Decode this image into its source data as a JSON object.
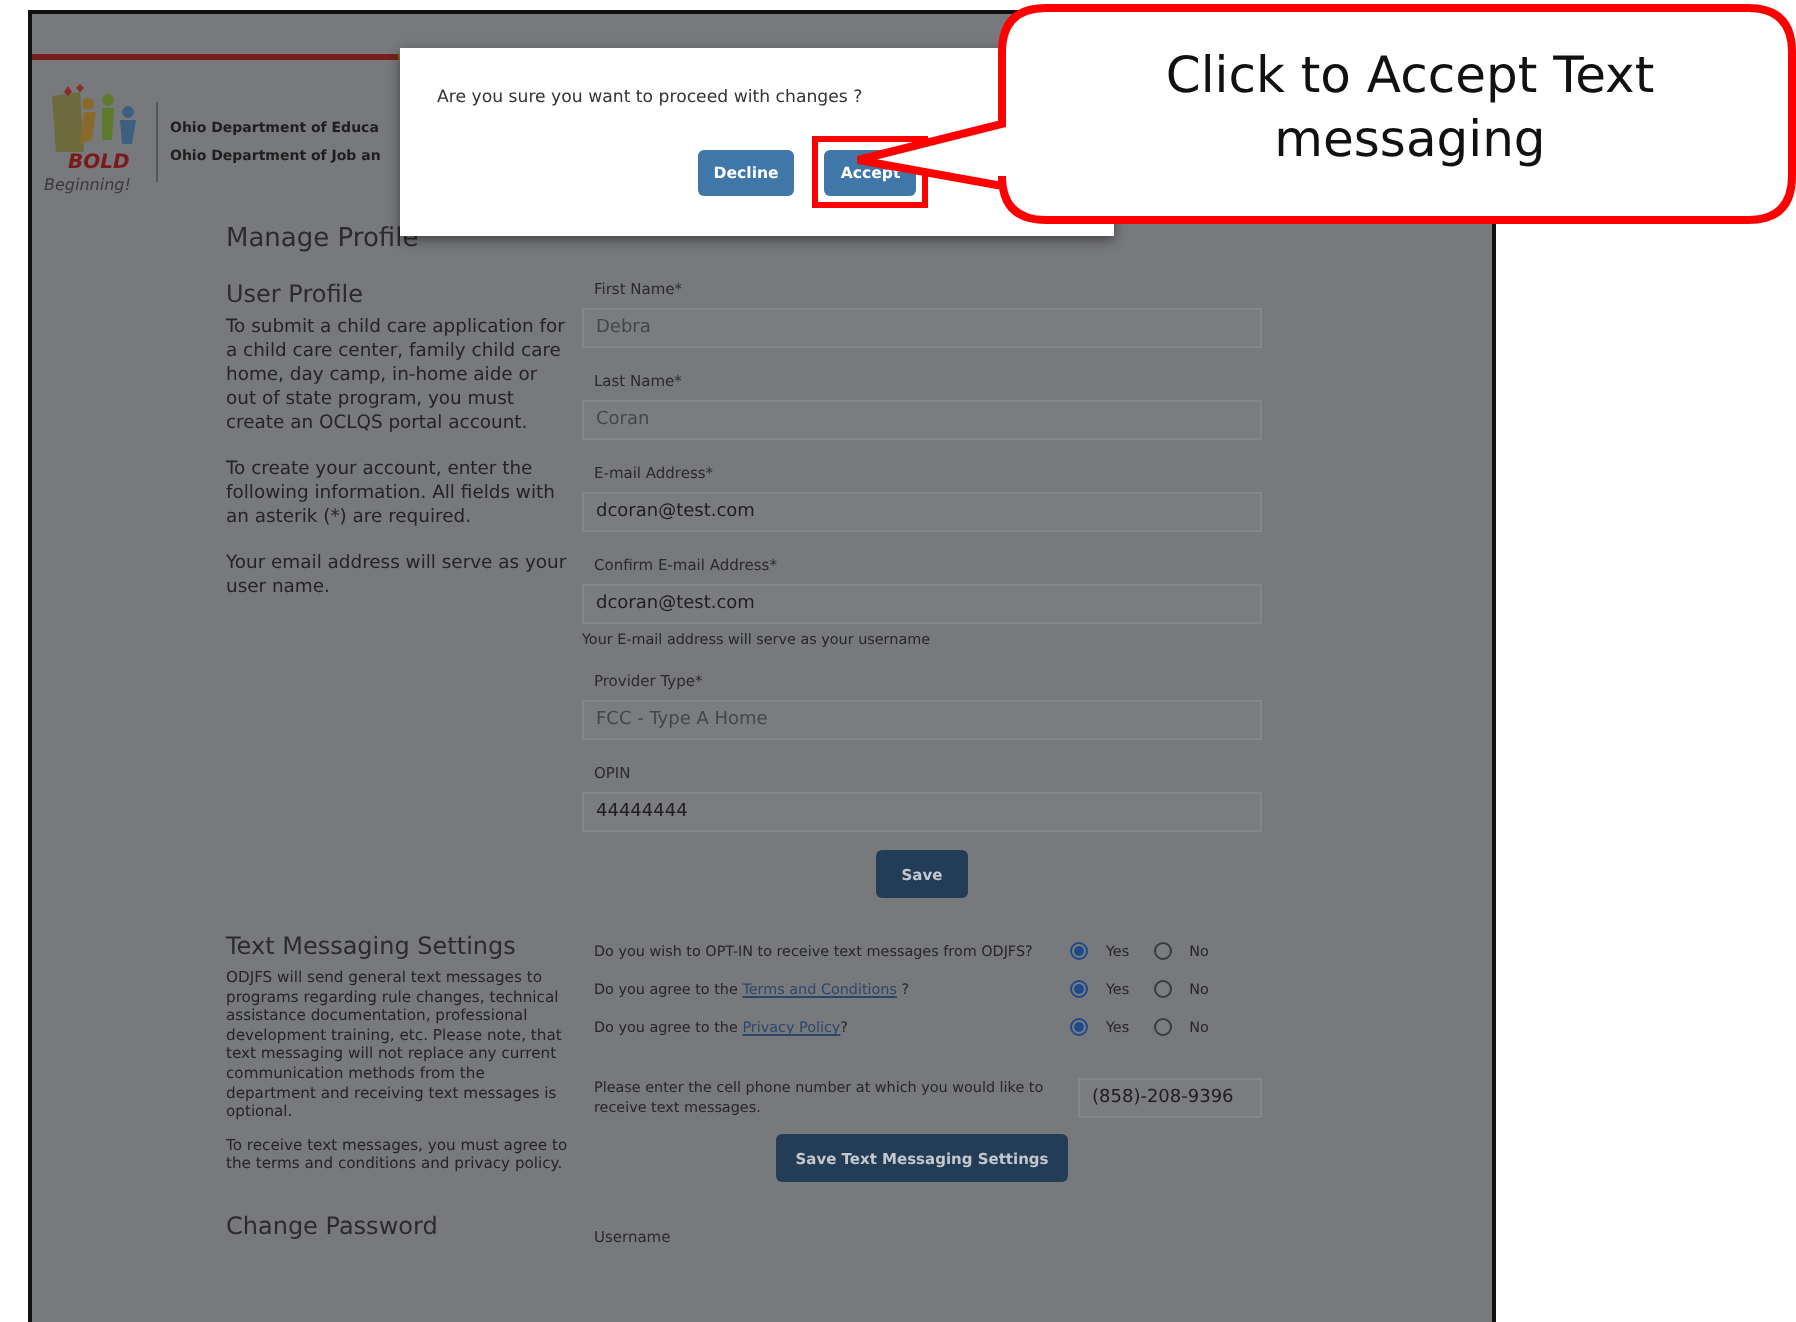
{
  "header": {
    "logo_word": "BOLD",
    "logo_tagline": "Beginning!",
    "departments": [
      "Ohio Department of Educa",
      "Ohio Department of Job an"
    ]
  },
  "page_title": "Manage Profile",
  "user_profile": {
    "title": "User Profile",
    "paragraphs": [
      "To submit a child care application for a child care center, family child care home, day camp, in-home aide or out of state program, you must create an OCLQS portal account.",
      "To create your account, enter the following information. All fields with an asterik (*) are required.",
      "Your email address will serve as your user name."
    ],
    "fields": [
      {
        "label": "First Name*",
        "value": "Debra",
        "disabled": true
      },
      {
        "label": "Last Name*",
        "value": "Coran",
        "disabled": true
      },
      {
        "label": "E-mail Address*",
        "value": "dcoran@test.com",
        "disabled": false
      },
      {
        "label": "Confirm E-mail Address*",
        "value": "dcoran@test.com",
        "disabled": false,
        "hint": "Your E-mail address will serve as your username"
      },
      {
        "label": "Provider Type*",
        "value": "FCC - Type A Home",
        "disabled": true
      },
      {
        "label": "OPIN",
        "value": "44444444",
        "disabled": false
      }
    ],
    "save_button": "Save"
  },
  "text_messaging": {
    "title": "Text Messaging Settings",
    "paragraphs": [
      "ODJFS will send general text messages to programs regarding rule changes, technical assistance documentation, professional development training, etc. Please note, that text messaging will not replace any current communication methods from the department and receiving text messages is optional.",
      "To receive text messages, you must agree to the terms and conditions and privacy policy."
    ],
    "questions": [
      {
        "text": "Do you wish to OPT-IN to receive text messages from ODJFS?",
        "options": [
          {
            "label": "Yes",
            "selected": true
          },
          {
            "label": "No",
            "selected": false
          }
        ]
      },
      {
        "text": "Do you agree to the ",
        "link": "Terms and Conditions",
        "after": " ?",
        "options": [
          {
            "label": "Yes",
            "selected": true
          },
          {
            "label": "No",
            "selected": false
          }
        ]
      },
      {
        "text": "Do you agree to the ",
        "link": "Privacy Policy",
        "after": "?",
        "options": [
          {
            "label": "Yes",
            "selected": true
          },
          {
            "label": "No",
            "selected": false
          }
        ]
      }
    ],
    "phone_prompt": "Please enter the cell phone number at which you would like to receive text messages.",
    "phone_value": "(858)-208-9396",
    "save_button": "Save Text Messaging Settings"
  },
  "change_password": {
    "title": "Change Password",
    "field_label": "Username"
  },
  "dialog": {
    "message": "Are you sure you want to proceed with changes ?",
    "buttons": [
      {
        "label": "Decline",
        "highlighted": false
      },
      {
        "label": "Accept",
        "highlighted": true
      }
    ]
  },
  "callout": {
    "text": "Click to Accept Text messaging"
  }
}
